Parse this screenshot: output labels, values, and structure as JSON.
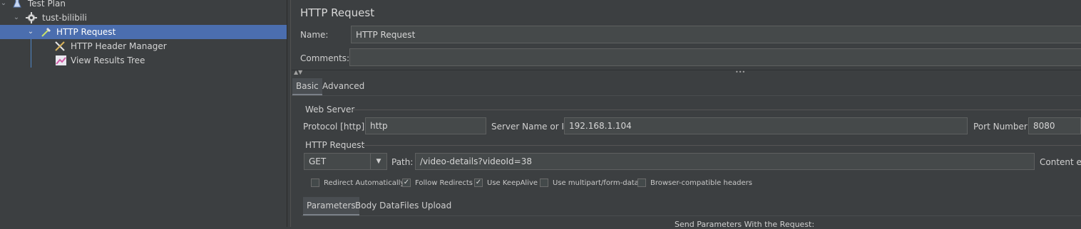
{
  "tree": {
    "items": [
      {
        "label": "Test Plan"
      },
      {
        "label": "tust-bilibili"
      },
      {
        "label": "HTTP Request"
      },
      {
        "label": "HTTP Header Manager"
      },
      {
        "label": "View Results Tree"
      }
    ]
  },
  "panel": {
    "title": "HTTP Request",
    "name_label": "Name:",
    "name_value": "HTTP Request",
    "comments_label": "Comments:",
    "comments_value": "",
    "dots": "•••",
    "tabs": [
      "Basic",
      "Advanced"
    ],
    "web_server": {
      "title": "Web Server",
      "protocol_label": "Protocol [http]:",
      "protocol_value": "http",
      "server_label": "Server Name or IP:",
      "server_value": "192.168.1.104",
      "port_label": "Port Number:",
      "port_value": "8080"
    },
    "http_request": {
      "title": "HTTP Request",
      "method": "GET",
      "path_label": "Path:",
      "path_value": "/video-details?videoId=38",
      "content_label": "Content en"
    },
    "checkboxes": [
      {
        "label": "Redirect Automatically",
        "checked": false
      },
      {
        "label": "Follow Redirects",
        "checked": true
      },
      {
        "label": "Use KeepAlive",
        "checked": true
      },
      {
        "label": "Use multipart/form-data",
        "checked": false
      },
      {
        "label": "Browser-compatible headers",
        "checked": false
      }
    ],
    "subtabs": [
      "Parameters",
      "Body Data",
      "Files Upload"
    ],
    "send_params": "Send Parameters With the Request:",
    "check_mark": "✓"
  }
}
